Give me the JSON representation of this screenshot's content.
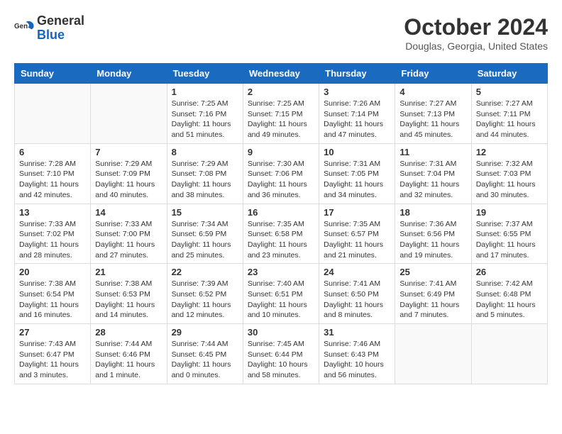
{
  "header": {
    "logo": {
      "general": "General",
      "blue": "Blue"
    },
    "title": "October 2024",
    "location": "Douglas, Georgia, United States"
  },
  "weekdays": [
    "Sunday",
    "Monday",
    "Tuesday",
    "Wednesday",
    "Thursday",
    "Friday",
    "Saturday"
  ],
  "weeks": [
    [
      {
        "day": "",
        "empty": true
      },
      {
        "day": "",
        "empty": true
      },
      {
        "day": "1",
        "sunrise": "7:25 AM",
        "sunset": "7:16 PM",
        "daylight": "11 hours and 51 minutes."
      },
      {
        "day": "2",
        "sunrise": "7:25 AM",
        "sunset": "7:15 PM",
        "daylight": "11 hours and 49 minutes."
      },
      {
        "day": "3",
        "sunrise": "7:26 AM",
        "sunset": "7:14 PM",
        "daylight": "11 hours and 47 minutes."
      },
      {
        "day": "4",
        "sunrise": "7:27 AM",
        "sunset": "7:13 PM",
        "daylight": "11 hours and 45 minutes."
      },
      {
        "day": "5",
        "sunrise": "7:27 AM",
        "sunset": "7:11 PM",
        "daylight": "11 hours and 44 minutes."
      }
    ],
    [
      {
        "day": "6",
        "sunrise": "7:28 AM",
        "sunset": "7:10 PM",
        "daylight": "11 hours and 42 minutes."
      },
      {
        "day": "7",
        "sunrise": "7:29 AM",
        "sunset": "7:09 PM",
        "daylight": "11 hours and 40 minutes."
      },
      {
        "day": "8",
        "sunrise": "7:29 AM",
        "sunset": "7:08 PM",
        "daylight": "11 hours and 38 minutes."
      },
      {
        "day": "9",
        "sunrise": "7:30 AM",
        "sunset": "7:06 PM",
        "daylight": "11 hours and 36 minutes."
      },
      {
        "day": "10",
        "sunrise": "7:31 AM",
        "sunset": "7:05 PM",
        "daylight": "11 hours and 34 minutes."
      },
      {
        "day": "11",
        "sunrise": "7:31 AM",
        "sunset": "7:04 PM",
        "daylight": "11 hours and 32 minutes."
      },
      {
        "day": "12",
        "sunrise": "7:32 AM",
        "sunset": "7:03 PM",
        "daylight": "11 hours and 30 minutes."
      }
    ],
    [
      {
        "day": "13",
        "sunrise": "7:33 AM",
        "sunset": "7:02 PM",
        "daylight": "11 hours and 28 minutes."
      },
      {
        "day": "14",
        "sunrise": "7:33 AM",
        "sunset": "7:00 PM",
        "daylight": "11 hours and 27 minutes."
      },
      {
        "day": "15",
        "sunrise": "7:34 AM",
        "sunset": "6:59 PM",
        "daylight": "11 hours and 25 minutes."
      },
      {
        "day": "16",
        "sunrise": "7:35 AM",
        "sunset": "6:58 PM",
        "daylight": "11 hours and 23 minutes."
      },
      {
        "day": "17",
        "sunrise": "7:35 AM",
        "sunset": "6:57 PM",
        "daylight": "11 hours and 21 minutes."
      },
      {
        "day": "18",
        "sunrise": "7:36 AM",
        "sunset": "6:56 PM",
        "daylight": "11 hours and 19 minutes."
      },
      {
        "day": "19",
        "sunrise": "7:37 AM",
        "sunset": "6:55 PM",
        "daylight": "11 hours and 17 minutes."
      }
    ],
    [
      {
        "day": "20",
        "sunrise": "7:38 AM",
        "sunset": "6:54 PM",
        "daylight": "11 hours and 16 minutes."
      },
      {
        "day": "21",
        "sunrise": "7:38 AM",
        "sunset": "6:53 PM",
        "daylight": "11 hours and 14 minutes."
      },
      {
        "day": "22",
        "sunrise": "7:39 AM",
        "sunset": "6:52 PM",
        "daylight": "11 hours and 12 minutes."
      },
      {
        "day": "23",
        "sunrise": "7:40 AM",
        "sunset": "6:51 PM",
        "daylight": "11 hours and 10 minutes."
      },
      {
        "day": "24",
        "sunrise": "7:41 AM",
        "sunset": "6:50 PM",
        "daylight": "11 hours and 8 minutes."
      },
      {
        "day": "25",
        "sunrise": "7:41 AM",
        "sunset": "6:49 PM",
        "daylight": "11 hours and 7 minutes."
      },
      {
        "day": "26",
        "sunrise": "7:42 AM",
        "sunset": "6:48 PM",
        "daylight": "11 hours and 5 minutes."
      }
    ],
    [
      {
        "day": "27",
        "sunrise": "7:43 AM",
        "sunset": "6:47 PM",
        "daylight": "11 hours and 3 minutes."
      },
      {
        "day": "28",
        "sunrise": "7:44 AM",
        "sunset": "6:46 PM",
        "daylight": "11 hours and 1 minute."
      },
      {
        "day": "29",
        "sunrise": "7:44 AM",
        "sunset": "6:45 PM",
        "daylight": "11 hours and 0 minutes."
      },
      {
        "day": "30",
        "sunrise": "7:45 AM",
        "sunset": "6:44 PM",
        "daylight": "10 hours and 58 minutes."
      },
      {
        "day": "31",
        "sunrise": "7:46 AM",
        "sunset": "6:43 PM",
        "daylight": "10 hours and 56 minutes."
      },
      {
        "day": "",
        "empty": true
      },
      {
        "day": "",
        "empty": true
      }
    ]
  ],
  "labels": {
    "sunrise": "Sunrise:",
    "sunset": "Sunset:",
    "daylight": "Daylight:"
  }
}
